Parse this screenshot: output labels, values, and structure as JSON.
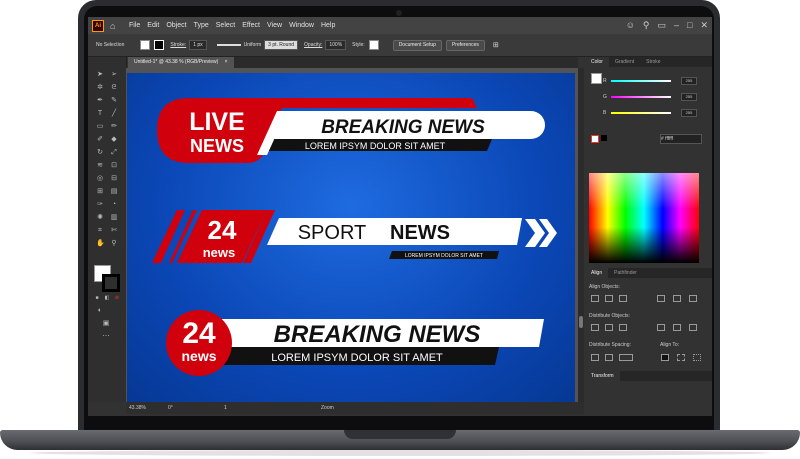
{
  "menubar": {
    "app_logo": "Ai",
    "items": [
      "File",
      "Edit",
      "Object",
      "Type",
      "Select",
      "Effect",
      "View",
      "Window",
      "Help"
    ]
  },
  "controlbar": {
    "selection_label": "No Selection",
    "stroke_label": "Stroke:",
    "stroke_weight": "1 px",
    "stroke_profile": "Uniform",
    "brush": "3 pt. Round",
    "opacity_label": "Opacity:",
    "opacity_value": "100%",
    "style_label": "Style:",
    "document_setup": "Document Setup",
    "preferences": "Preferences"
  },
  "document_tab": {
    "title": "Untitled-1* @ 43.38 % (RGB/Preview)",
    "close": "×"
  },
  "artwork": {
    "banner1": {
      "badge_top": "LIVE",
      "badge_bottom": "NEWS",
      "headline": "BREAKING NEWS",
      "subline": "LOREM IPSYM DOLOR SIT AMET"
    },
    "banner2": {
      "badge_top": "24",
      "badge_bottom": "news",
      "headline_light": "SPORT",
      "headline_bold": "NEWS",
      "subline": "LOREM IPSYM DOLOR SIT AMET"
    },
    "banner3": {
      "badge_top": "24",
      "badge_bottom": "news",
      "headline": "BREAKING NEWS",
      "subline": "LOREM IPSYM DOLOR SIT AMET"
    }
  },
  "statusbar": {
    "zoom": "43.38%",
    "rotation": "0°",
    "artboard_number": "1",
    "tool_name": "Zoom"
  },
  "color_panel": {
    "tabs": [
      "Color",
      "Gradient",
      "Stroke"
    ],
    "r_label": "R",
    "r_value": "255",
    "g_label": "G",
    "g_value": "255",
    "b_label": "B",
    "b_value": "255",
    "hex_prefix": "#",
    "hex_value": "ffffff"
  },
  "align_panel": {
    "tabs": [
      "Align",
      "Pathfinder"
    ],
    "align_objects": "Align Objects:",
    "distribute_objects": "Distribute Objects:",
    "distribute_spacing": "Distribute Spacing:",
    "align_to": "Align To:"
  },
  "transform_panel": {
    "title": "Transform"
  },
  "colors": {
    "artboard_blue": "#0b47b6",
    "banner_red": "#d0000c",
    "accent_orange": "#ff9a00"
  }
}
